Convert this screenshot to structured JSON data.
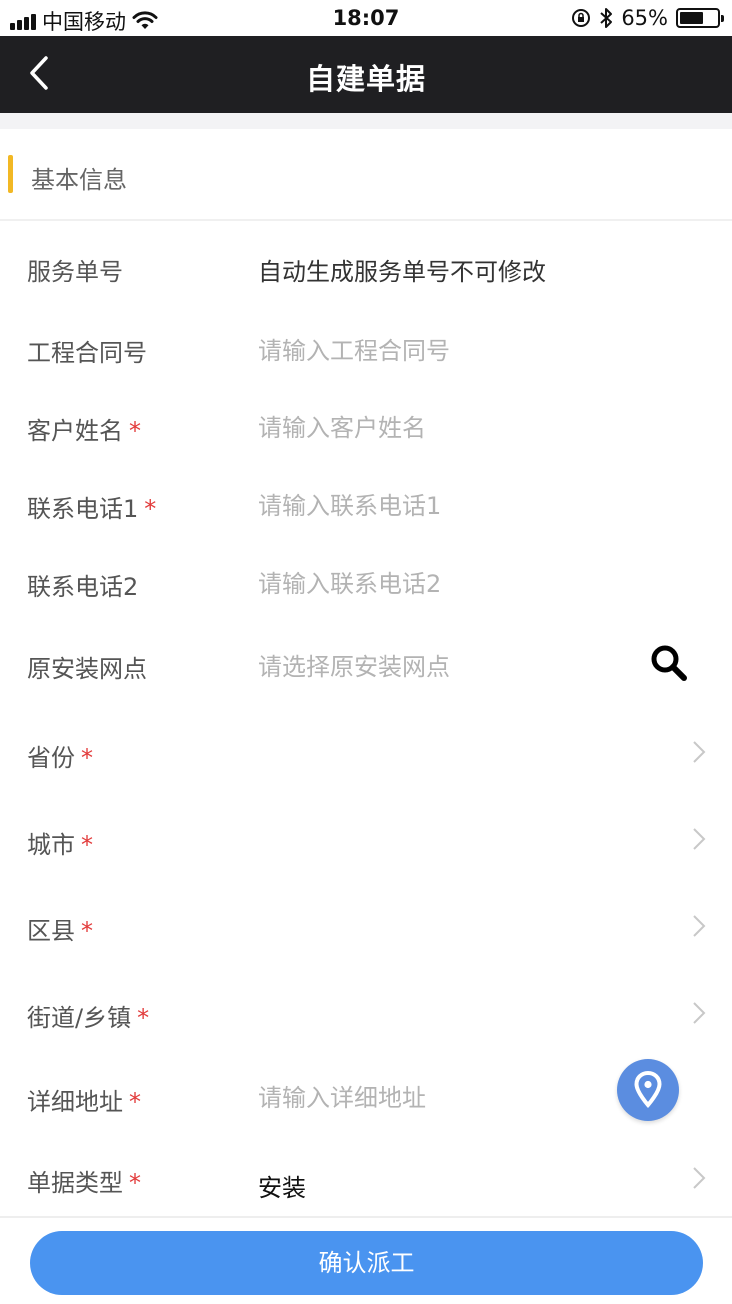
{
  "status_bar": {
    "carrier": "中国移动",
    "time": "18:07",
    "battery_percent": "65%",
    "battery_level": 0.65
  },
  "nav": {
    "title": "自建单据",
    "back_icon": "chevron-left-icon"
  },
  "section": {
    "title": "基本信息",
    "accent_color": "#f2b824"
  },
  "form": {
    "required_mark": "*",
    "service_no": {
      "label": "服务单号",
      "value": "自动生成服务单号不可修改"
    },
    "contract_no": {
      "label": "工程合同号",
      "placeholder": "请输入工程合同号"
    },
    "customer_name": {
      "label": "客户姓名",
      "placeholder": "请输入客户姓名"
    },
    "phone1": {
      "label": "联系电话1",
      "placeholder": "请输入联系电话1"
    },
    "phone2": {
      "label": "联系电话2",
      "placeholder": "请输入联系电话2"
    },
    "origin_site": {
      "label": "原安装网点",
      "placeholder": "请选择原安装网点"
    },
    "province": {
      "label": "省份"
    },
    "city": {
      "label": "城市"
    },
    "district": {
      "label": "区县"
    },
    "street": {
      "label": "街道/乡镇"
    },
    "address": {
      "label": "详细地址",
      "placeholder": "请输入详细地址"
    },
    "order_type": {
      "label": "单据类型",
      "value": "安装"
    }
  },
  "confirm_button": {
    "label": "确认派工",
    "color": "#4a94f0"
  }
}
